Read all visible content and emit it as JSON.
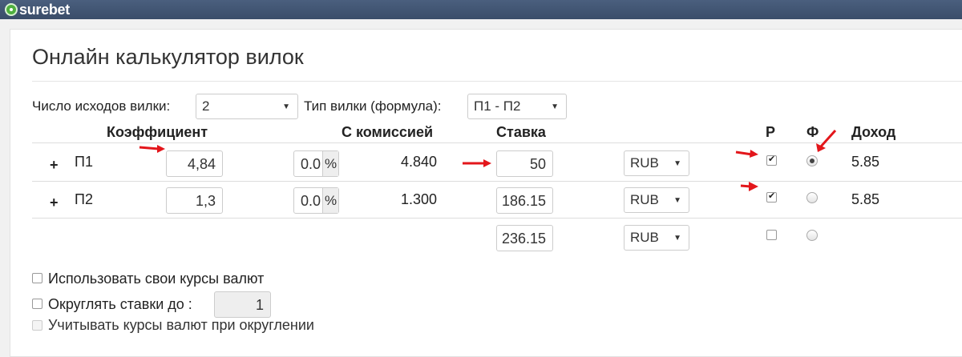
{
  "app": {
    "brand": "surebet"
  },
  "title": "Онлайн калькулятор вилок",
  "controls": {
    "outcomes_label": "Число исходов вилки:",
    "outcomes_value": "2",
    "fork_type_label": "Тип вилки (формула):",
    "fork_type_value": "П1 - П2"
  },
  "table": {
    "headers": {
      "coefficient": "Коэффициент",
      "with_commission": "С комиссией",
      "stake": "Ставка",
      "r": "Р",
      "f": "Ф",
      "income": "Доход"
    },
    "rows": [
      {
        "plus": "+",
        "label": "П1",
        "coefficient": "4,84",
        "commission": "0.0",
        "commission_unit": "%",
        "with_commission": "4.840",
        "stake": "50",
        "currency": "RUB",
        "r_checked": true,
        "f_checked": true,
        "income": "5.85"
      },
      {
        "plus": "+",
        "label": "П2",
        "coefficient": "1,3",
        "commission": "0.0",
        "commission_unit": "%",
        "with_commission": "1.300",
        "stake": "186.15",
        "currency": "RUB",
        "r_checked": true,
        "f_checked": false,
        "income": "5.85"
      }
    ],
    "total": {
      "stake": "236.15",
      "currency": "RUB",
      "r_checked": false,
      "f_checked": false
    }
  },
  "options": {
    "own_rates": "Использовать свои курсы валют",
    "round_stakes": "Округлять ставки до :",
    "round_value": "1",
    "consider_rates": "Учитывать курсы валют при округлении"
  },
  "colors": {
    "topbar": "#3f5372",
    "annotation_arrow": "#e3161b"
  }
}
